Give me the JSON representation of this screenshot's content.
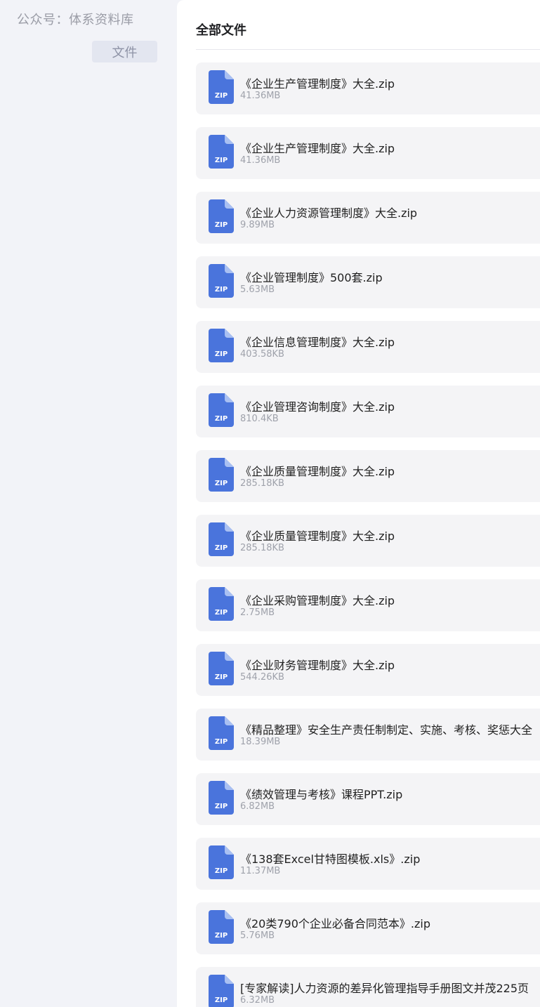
{
  "sidebar": {
    "brand": "公众号：体系资料库",
    "tab_label": "文件"
  },
  "main": {
    "title": "全部文件"
  },
  "icon_label": "ZIP",
  "colors": {
    "icon_primary": "#4a74dc",
    "icon_fold": "#a9c0f2",
    "card_bg": "#f4f4f6"
  },
  "files": [
    {
      "name": "《企业生产管理制度》大全.zip",
      "size": "41.36MB"
    },
    {
      "name": "《企业生产管理制度》大全.zip",
      "size": "41.36MB"
    },
    {
      "name": "《企业人力资源管理制度》大全.zip",
      "size": "9.89MB"
    },
    {
      "name": "《企业管理制度》500套.zip",
      "size": "5.63MB"
    },
    {
      "name": "《企业信息管理制度》大全.zip",
      "size": "403.58KB"
    },
    {
      "name": "《企业管理咨询制度》大全.zip",
      "size": "810.4KB"
    },
    {
      "name": "《企业质量管理制度》大全.zip",
      "size": "285.18KB"
    },
    {
      "name": "《企业质量管理制度》大全.zip",
      "size": "285.18KB"
    },
    {
      "name": "《企业采购管理制度》大全.zip",
      "size": "2.75MB"
    },
    {
      "name": "《企业财务管理制度》大全.zip",
      "size": "544.26KB"
    },
    {
      "name": "《精品整理》安全生产责任制制定、实施、考核、奖惩大全",
      "size": "18.39MB"
    },
    {
      "name": "《绩效管理与考核》课程PPT.zip",
      "size": "6.82MB"
    },
    {
      "name": "《138套Excel甘特图模板.xls》.zip",
      "size": "11.37MB"
    },
    {
      "name": "《20类790个企业必备合同范本》.zip",
      "size": "5.76MB"
    },
    {
      "name": "[专家解读]人力资源的差异化管理指导手册图文并茂225页",
      "size": "6.32MB"
    }
  ]
}
